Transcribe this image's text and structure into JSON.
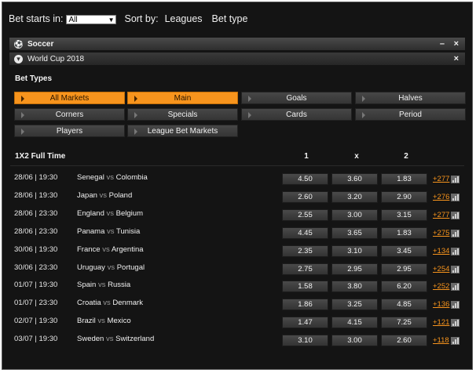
{
  "filters": {
    "bet_starts_label": "Bet starts in:",
    "bet_starts_value": "All",
    "sort_label": "Sort by:",
    "sort_options": [
      "Leagues",
      "Bet type"
    ]
  },
  "sport_header": {
    "title": "Soccer",
    "minimize": "–",
    "close": "×"
  },
  "league_header": {
    "title": "World Cup 2018",
    "close": "×"
  },
  "bet_types": {
    "title": "Bet Types",
    "buttons": [
      {
        "label": "All Markets",
        "active": true
      },
      {
        "label": "Main",
        "active": true
      },
      {
        "label": "Goals",
        "active": false
      },
      {
        "label": "Halves",
        "active": false
      },
      {
        "label": "Corners",
        "active": false
      },
      {
        "label": "Specials",
        "active": false
      },
      {
        "label": "Cards",
        "active": false
      },
      {
        "label": "Period",
        "active": false
      },
      {
        "label": "Players",
        "active": false
      },
      {
        "label": "League Bet Markets",
        "active": false
      }
    ]
  },
  "market": {
    "title": "1X2 Full Time",
    "columns": [
      "1",
      "x",
      "2"
    ],
    "vs": "vs",
    "matches": [
      {
        "datetime": "28/06 | 19:30",
        "home": "Senegal",
        "away": "Colombia",
        "odds": [
          "4.50",
          "3.60",
          "1.83"
        ],
        "more": "+277"
      },
      {
        "datetime": "28/06 | 19:30",
        "home": "Japan",
        "away": "Poland",
        "odds": [
          "2.60",
          "3.20",
          "2.90"
        ],
        "more": "+276"
      },
      {
        "datetime": "28/06 | 23:30",
        "home": "England",
        "away": "Belgium",
        "odds": [
          "2.55",
          "3.00",
          "3.15"
        ],
        "more": "+277"
      },
      {
        "datetime": "28/06 | 23:30",
        "home": "Panama",
        "away": "Tunisia",
        "odds": [
          "4.45",
          "3.65",
          "1.83"
        ],
        "more": "+275"
      },
      {
        "datetime": "30/06 | 19:30",
        "home": "France",
        "away": "Argentina",
        "odds": [
          "2.35",
          "3.10",
          "3.45"
        ],
        "more": "+134"
      },
      {
        "datetime": "30/06 | 23:30",
        "home": "Uruguay",
        "away": "Portugal",
        "odds": [
          "2.75",
          "2.95",
          "2.95"
        ],
        "more": "+254"
      },
      {
        "datetime": "01/07 | 19:30",
        "home": "Spain",
        "away": "Russia",
        "odds": [
          "1.58",
          "3.80",
          "6.20"
        ],
        "more": "+252"
      },
      {
        "datetime": "01/07 | 23:30",
        "home": "Croatia",
        "away": "Denmark",
        "odds": [
          "1.86",
          "3.25",
          "4.85"
        ],
        "more": "+136"
      },
      {
        "datetime": "02/07 | 19:30",
        "home": "Brazil",
        "away": "Mexico",
        "odds": [
          "1.47",
          "4.15",
          "7.25"
        ],
        "more": "+121"
      },
      {
        "datetime": "03/07 | 19:30",
        "home": "Sweden",
        "away": "Switzerland",
        "odds": [
          "3.10",
          "3.00",
          "2.60"
        ],
        "more": "+118"
      }
    ]
  },
  "colors": {
    "accent": "#f7941d",
    "background": "#141414"
  }
}
